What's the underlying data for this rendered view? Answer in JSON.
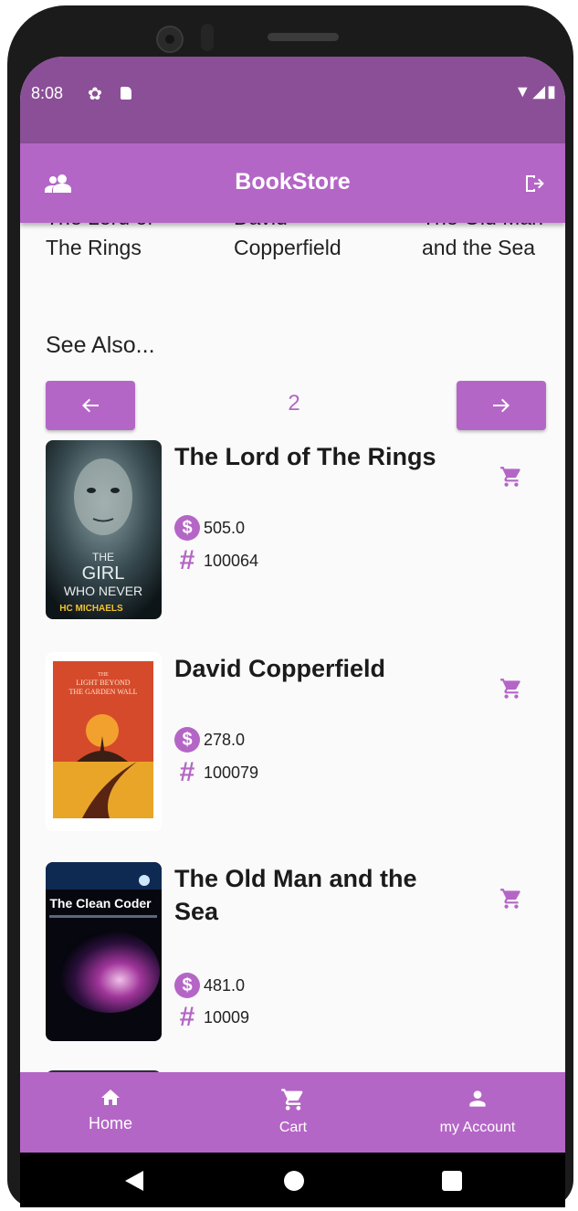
{
  "status_bar": {
    "time": "8:08",
    "gear_icon": "settings-gear",
    "right_icons": "▼◢▮"
  },
  "app_bar": {
    "title": "BookStore",
    "left_icon": "people-icon",
    "right_icon": "logout-icon"
  },
  "carousel": {
    "items": [
      {
        "line1": "The Lord of",
        "line2": "The Rings"
      },
      {
        "line1": "David",
        "line2": "Copperfield"
      },
      {
        "line1": "The Old Man",
        "line2": "and the Sea"
      }
    ]
  },
  "see_also": {
    "heading": "See Also...",
    "page_number": "2",
    "prev_icon": "arrow-left-icon",
    "next_icon": "arrow-right-icon"
  },
  "books": [
    {
      "title": "The Lord of The Rings",
      "price": "505.0",
      "id": "100064",
      "cover_text_1": "THE",
      "cover_text_2": "GIRL",
      "cover_text_3": "WHO NEVER",
      "cover_author": "HC MICHAELS"
    },
    {
      "title": "David Copperfield",
      "price": "278.0",
      "id": "100079",
      "cover_text_1": "THE",
      "cover_text_2": "LIGHT BEYOND",
      "cover_text_3": "THE GARDEN WALL"
    },
    {
      "title": "The Old Man and the Sea",
      "price": "481.0",
      "id": "10009",
      "cover_text_1": "The Clean Coder"
    }
  ],
  "bottom_nav": [
    {
      "label": "Home",
      "icon": "home-icon"
    },
    {
      "label": "Cart",
      "icon": "cart-icon"
    },
    {
      "label": "my Account",
      "icon": "person-icon"
    }
  ],
  "colors": {
    "accent": "#b466c6",
    "status_bar": "#8b4f97",
    "background": "#fafafa"
  }
}
